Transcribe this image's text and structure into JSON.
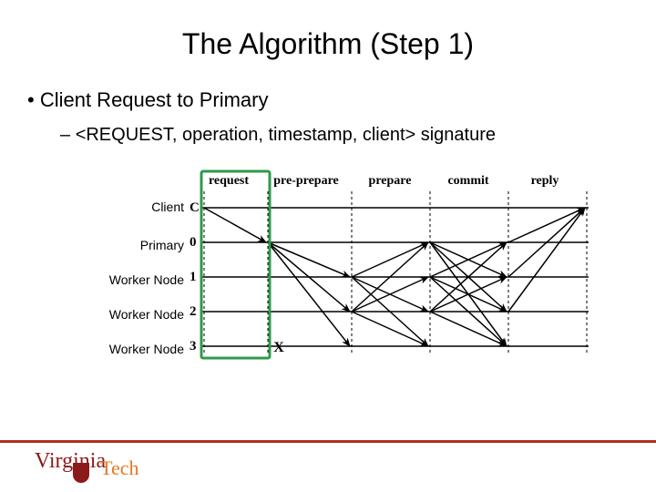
{
  "title": "The Algorithm (Step 1)",
  "bullet1": "Client Request to Primary",
  "bullet2": "<REQUEST, operation, timestamp, client> signature",
  "rows": {
    "client": "Client",
    "primary": "Primary",
    "worker1": "Worker Node",
    "worker2": "Worker Node",
    "worker3": "Worker Node"
  },
  "nodes": {
    "c": "C",
    "n0": "0",
    "n1": "1",
    "n2": "2",
    "n3": "3"
  },
  "phases": {
    "request": "request",
    "preprepare": "pre-prepare",
    "prepare": "prepare",
    "commit": "commit",
    "reply": "reply"
  },
  "faultMark": "X",
  "logo": {
    "virginia": "Virginia",
    "tech": "Tech"
  }
}
